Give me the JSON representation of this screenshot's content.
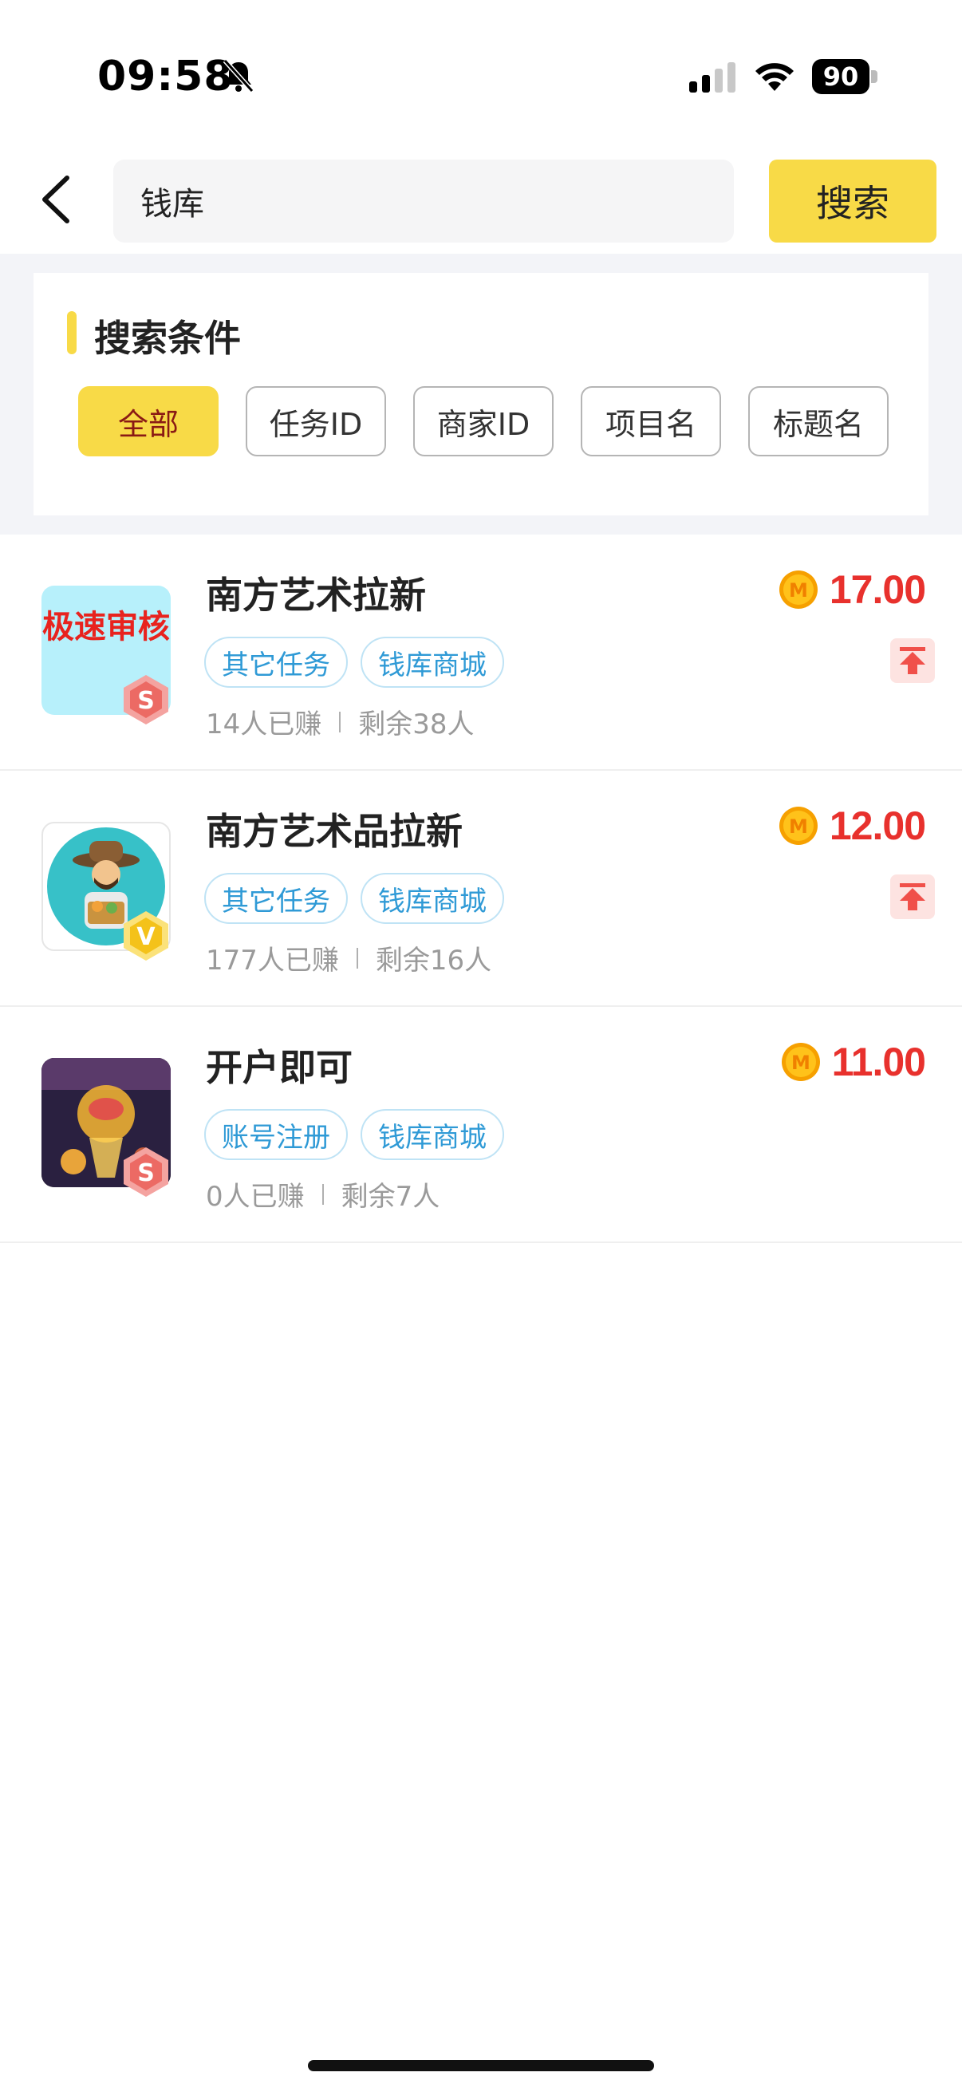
{
  "status": {
    "time": "09:58",
    "battery": "90"
  },
  "search": {
    "value": "钱库",
    "button_label": "搜索"
  },
  "criteria": {
    "title": "搜索条件",
    "chips": [
      {
        "label": "全部",
        "active": true
      },
      {
        "label": "任务ID",
        "active": false
      },
      {
        "label": "商家ID",
        "active": false
      },
      {
        "label": "项目名",
        "active": false
      },
      {
        "label": "标题名",
        "active": false
      }
    ]
  },
  "items": [
    {
      "title": "南方艺术拉新",
      "thumb_text": "极速审核",
      "badge": "S",
      "tags": [
        "其它任务",
        "钱库商城"
      ],
      "earned": "14人已赚",
      "remaining": "剩余38人",
      "price": "17.00",
      "pinned": true
    },
    {
      "title": "南方艺术品拉新",
      "thumb_text": "",
      "badge": "V",
      "tags": [
        "其它任务",
        "钱库商城"
      ],
      "earned": "177人已赚",
      "remaining": "剩余16人",
      "price": "12.00",
      "pinned": true
    },
    {
      "title": "开户即可",
      "thumb_text": "",
      "badge": "S",
      "tags": [
        "账号注册",
        "钱库商城"
      ],
      "earned": "0人已赚",
      "remaining": "剩余7人",
      "price": "11.00",
      "pinned": false
    }
  ],
  "coin_symbol": "M",
  "colors": {
    "accent_yellow": "#f8da47",
    "price_red": "#e8312d",
    "tag_blue": "#2f9ad6"
  }
}
